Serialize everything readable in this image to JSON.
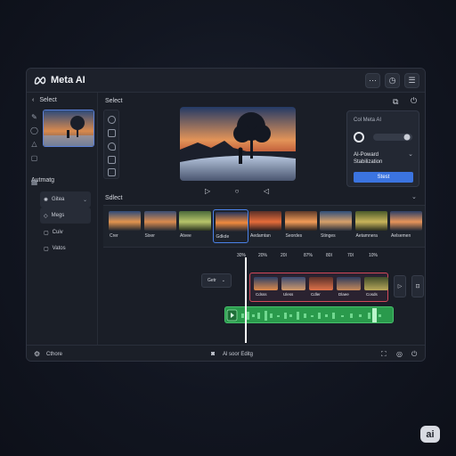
{
  "app": {
    "title": "Meta AI"
  },
  "sidebar": {
    "back_label": "Select",
    "section_label": "Autmatg",
    "items": [
      {
        "label": "Gitea",
        "icon": "sparkle-icon"
      },
      {
        "label": "Megs",
        "icon": "diamond-icon"
      },
      {
        "label": "Cuiv",
        "icon": "square-icon"
      },
      {
        "label": "Vatos",
        "icon": "square-icon"
      }
    ]
  },
  "main": {
    "select_label": "Select",
    "strip_label": "Sdlect"
  },
  "panel": {
    "title": "Col Meta AI",
    "feature_line1": "AI-Poward",
    "feature_line2": "Stabilization",
    "start_label": "Stest"
  },
  "filmstrip": {
    "items": [
      {
        "label": "Crer"
      },
      {
        "label": "Sixer"
      },
      {
        "label": "Atvee"
      },
      {
        "label": "Gdkde",
        "selected": true
      },
      {
        "label": "Aedamtan"
      },
      {
        "label": "Seordes"
      },
      {
        "label": "Stinges"
      },
      {
        "label": "Aetamnera"
      },
      {
        "label": "Aelsemen"
      }
    ]
  },
  "timeline": {
    "percentages": [
      "30%",
      "20%",
      "20I",
      "87%",
      "80I",
      "70I",
      "10%"
    ],
    "gear_label": "Getr",
    "clips": [
      {
        "label": "Cdsss"
      },
      {
        "label": "Uless"
      },
      {
        "label": "Cdler"
      },
      {
        "label": "Dlaee"
      },
      {
        "label": "Cosds"
      }
    ]
  },
  "statusbar": {
    "left_label": "Cthore",
    "center_label": "Al soor Editg"
  },
  "watermark": "ai"
}
